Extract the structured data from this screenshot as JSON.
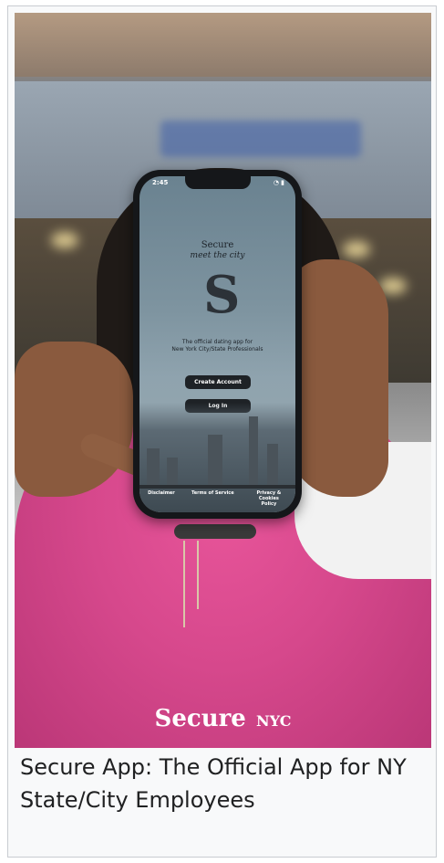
{
  "phone_screen": {
    "status_time": "2:45",
    "brand_word": "Secure",
    "brand_tagline": "meet the city",
    "logo_letter": "S",
    "tagline_line1": "The official dating app for",
    "tagline_line2": "New York City/State Professionals",
    "create_account_label": "Create Account",
    "login_label": "Log In",
    "footer_links": [
      "Disclaimer",
      "Terms of Service",
      "Privacy & Cookies Policy"
    ]
  },
  "watermark": {
    "brand": "Secure",
    "city": "NYC"
  },
  "caption": "Secure App: The Official App for NY State/City Employees",
  "colors": {
    "shirt": "#d6488c",
    "button": "#1e2226",
    "caption_text": "#202122"
  }
}
